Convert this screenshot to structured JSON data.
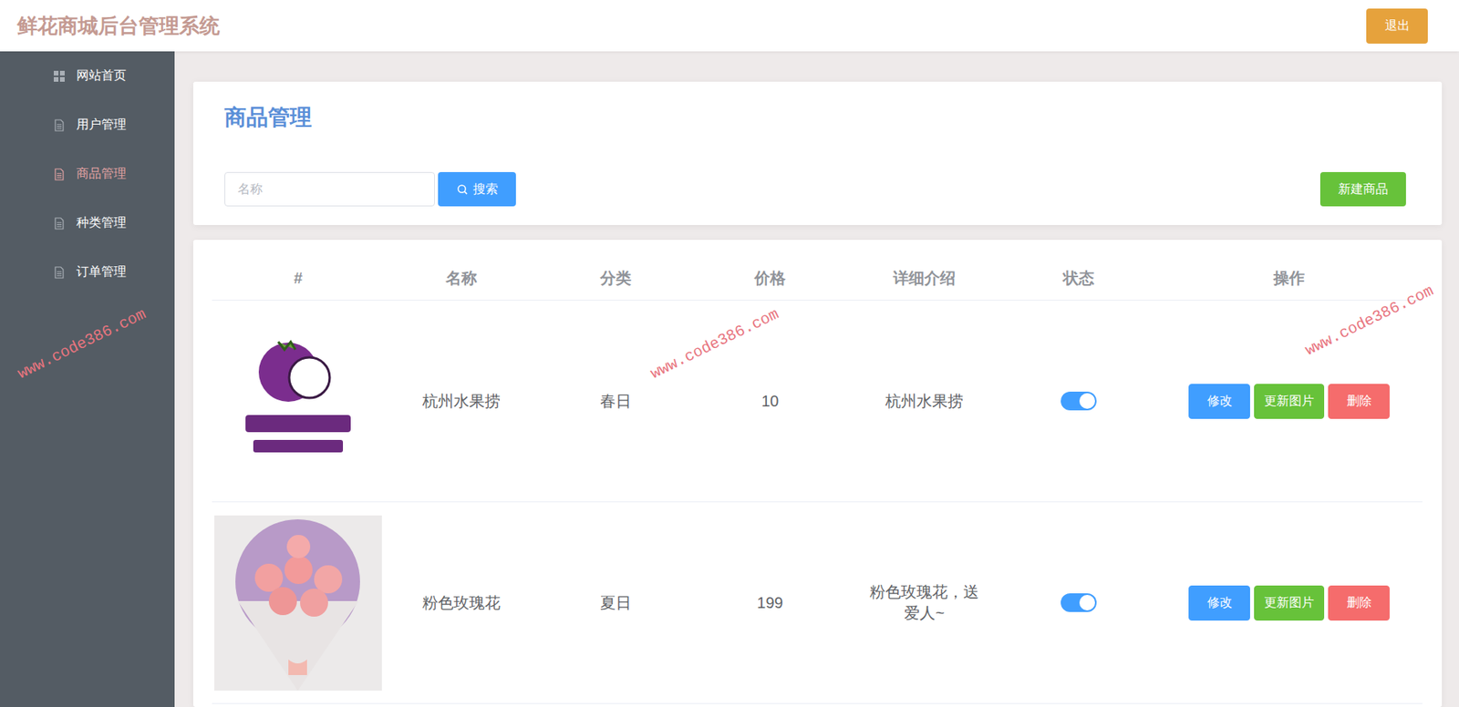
{
  "header": {
    "title": "鲜花商城后台管理系统",
    "logout": "退出"
  },
  "sidebar": {
    "items": [
      {
        "label": "网站首页",
        "kind": "grid",
        "selected": false
      },
      {
        "label": "用户管理",
        "kind": "doc",
        "selected": false
      },
      {
        "label": "商品管理",
        "kind": "doc",
        "selected": true
      },
      {
        "label": "种类管理",
        "kind": "doc",
        "selected": false
      },
      {
        "label": "订单管理",
        "kind": "doc",
        "selected": false
      }
    ]
  },
  "page": {
    "title": "商品管理",
    "search": {
      "placeholder": "名称",
      "button": "搜索"
    },
    "create": "新建商品"
  },
  "table": {
    "columns": [
      "#",
      "名称",
      "分类",
      "价格",
      "详细介绍",
      "状态",
      "操作"
    ],
    "rows": [
      {
        "image": "logo",
        "name": "杭州水果捞",
        "category": "春日",
        "price": "10",
        "description": "杭州水果捞",
        "on": true,
        "actions": [
          {
            "label": "修改",
            "color": "#409eff"
          },
          {
            "label": "更新图片",
            "color": "#67c23a"
          },
          {
            "label": "删除",
            "color": "#f56c6c"
          }
        ]
      },
      {
        "image": "bouquet",
        "name": "粉色玫瑰花",
        "category": "夏日",
        "price": "199",
        "description": "粉色玫瑰花，送爱人~",
        "on": true,
        "actions": [
          {
            "label": "修改",
            "color": "#409eff"
          },
          {
            "label": "更新图片",
            "color": "#67c23a"
          },
          {
            "label": "删除",
            "color": "#f56c6c"
          }
        ]
      }
    ]
  },
  "watermarks": [
    "www.code386.com",
    "www.code386.com",
    "www.code386.com"
  ]
}
